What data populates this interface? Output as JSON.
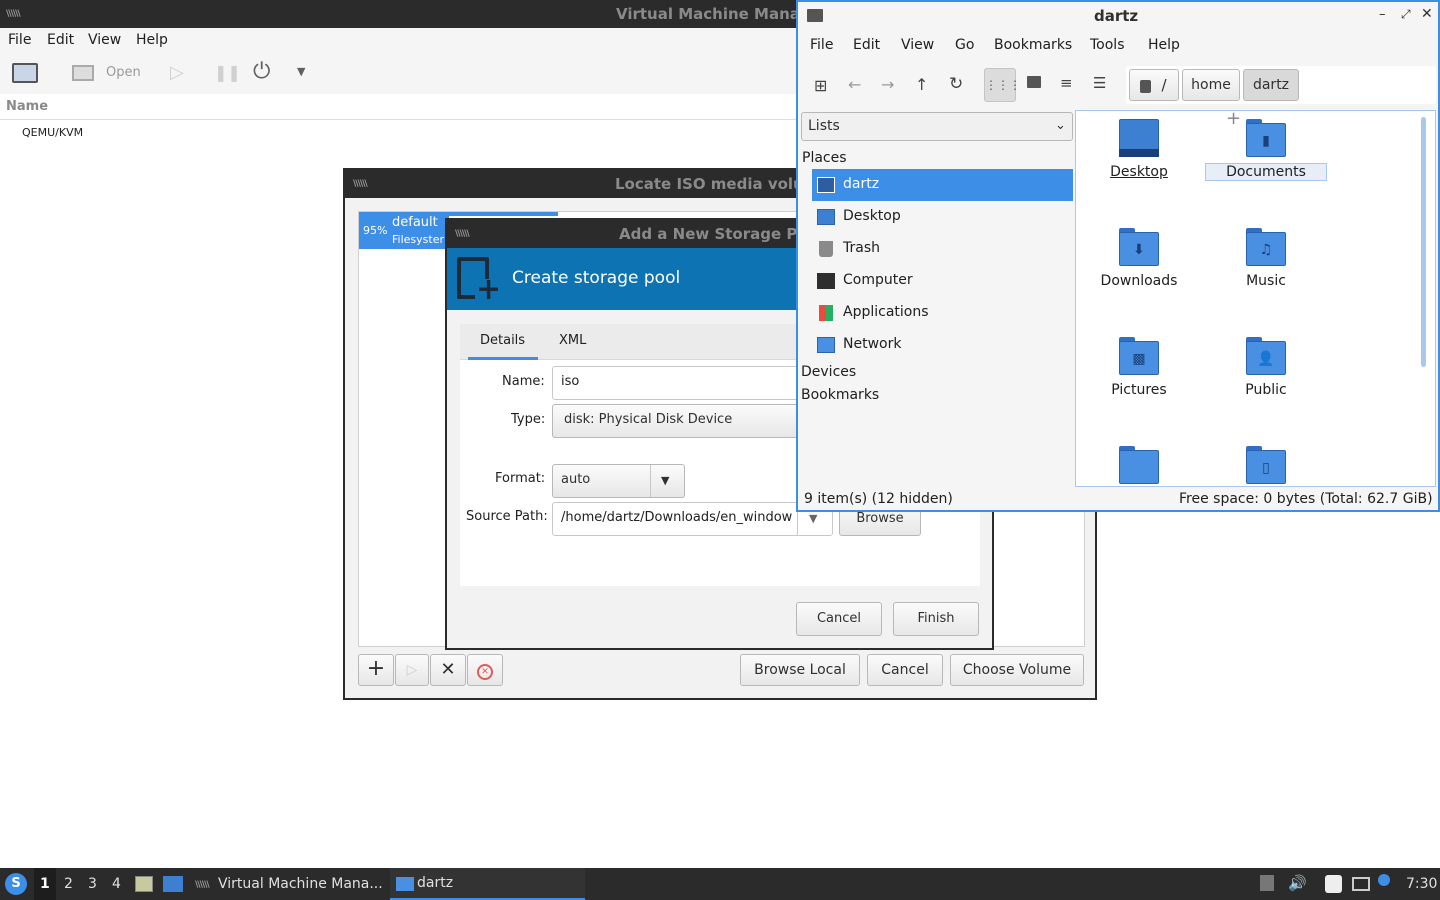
{
  "vmm": {
    "title": "Virtual Machine Mana",
    "menu": [
      "File",
      "Edit",
      "View",
      "Help"
    ],
    "toolbar": {
      "open_label": "Open"
    },
    "column_name": "Name",
    "connection": "QEMU/KVM"
  },
  "locate": {
    "title": "Locate ISO media volu",
    "pool": {
      "percent": "95%",
      "name": "default",
      "type": "Filesyster",
      "usage_fraction": 0.95
    },
    "buttons": {
      "browse_local": "Browse Local",
      "cancel": "Cancel",
      "choose_volume": "Choose Volume"
    },
    "tool_add": "+",
    "tool_delete": "✕"
  },
  "pool_dialog": {
    "title": "Add a New Storage P",
    "header": "Create storage pool",
    "tabs": [
      "Details",
      "XML"
    ],
    "name_label": "Name:",
    "name_value": "iso",
    "type_label": "Type:",
    "type_value": "disk: Physical Disk Device",
    "format_label": "Format:",
    "format_value": "auto",
    "source_label": "Source Path:",
    "source_value": "/home/dartz/Downloads/en_window",
    "browse": "Browse",
    "cancel": "Cancel",
    "finish": "Finish"
  },
  "files": {
    "title": "dartz",
    "menu": [
      "File",
      "Edit",
      "View",
      "Go",
      "Bookmarks",
      "Tools",
      "Help"
    ],
    "path": {
      "root": "/",
      "home": "home",
      "current": "dartz"
    },
    "sidepane_mode": "Lists",
    "places_heading": "Places",
    "places": [
      {
        "label": "dartz",
        "icon": "home-icon"
      },
      {
        "label": "Desktop",
        "icon": "desktop-icon"
      },
      {
        "label": "Trash",
        "icon": "trash-icon"
      },
      {
        "label": "Computer",
        "icon": "computer-icon"
      },
      {
        "label": "Applications",
        "icon": "applications-icon"
      },
      {
        "label": "Network",
        "icon": "network-icon"
      }
    ],
    "devices_heading": "Devices",
    "bookmarks_heading": "Bookmarks",
    "items": [
      "Desktop",
      "Documents",
      "Downloads",
      "Music",
      "Pictures",
      "Public"
    ],
    "status_left": "9 item(s) (12 hidden)",
    "status_right": "Free space: 0 bytes (Total: 62.7 GiB)"
  },
  "taskbar": {
    "workspaces": [
      "1",
      "2",
      "3",
      "4"
    ],
    "task_vmm": "Virtual Machine Mana...",
    "task_files": "dartz",
    "clock": "7:30"
  },
  "colors": {
    "accent": "#3d8ee6",
    "dialog_header": "#0e73b3",
    "titlebar": "#2b2b2b"
  }
}
